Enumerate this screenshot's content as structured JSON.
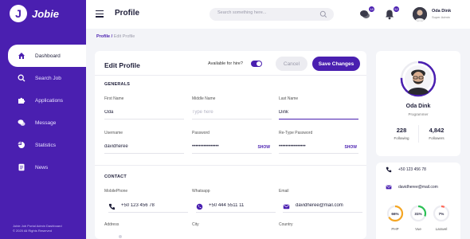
{
  "app": {
    "name": "Jobie",
    "logo_letter": "J",
    "footer_line1": "Jobie Job Portal Admin Dashboard",
    "footer_line2": "© 2020 All Rights Reserved"
  },
  "sidebar": {
    "items": [
      {
        "label": "Dashboard",
        "icon": "home-icon",
        "active": true
      },
      {
        "label": "Search Job",
        "icon": "search-icon"
      },
      {
        "label": "Applications",
        "icon": "puzzle-icon"
      },
      {
        "label": "Message",
        "icon": "chat-icon"
      },
      {
        "label": "Statistics",
        "icon": "pie-chart-icon"
      },
      {
        "label": "News",
        "icon": "document-icon"
      }
    ]
  },
  "header": {
    "title": "Profile",
    "search_placeholder": "Search something here...",
    "messages_count": "18",
    "notifications_count": "52",
    "user_name": "Oda Dink",
    "user_role": "Super Admin"
  },
  "breadcrumb": {
    "current": "Profile /",
    "sub": "Edit Profile"
  },
  "form": {
    "title": "Edit Profile",
    "hire_label": "Available for hire?",
    "hire_on": true,
    "cancel_label": "Cancel",
    "save_label": "Save Changes",
    "generals_title": "GENERALS",
    "contact_title": "CONTACT",
    "show_label": "SHOW",
    "first_name": {
      "label": "First Name",
      "value": "Oda"
    },
    "middle_name": {
      "label": "Middle Name",
      "placeholder": "Type here"
    },
    "last_name": {
      "label": "Last Name",
      "value": "Dink"
    },
    "username": {
      "label": "Username",
      "value": "davidheree"
    },
    "password": {
      "label": "Password",
      "value": "••••••••••••••••"
    },
    "retype_password": {
      "label": "Re-Type Password",
      "value": "••••••••••••••••"
    },
    "mobile": {
      "label": "MobilePhone",
      "value": "+50 123 456 78"
    },
    "whatsapp": {
      "label": "Whatsapp",
      "value": "+50 444 5511 11"
    },
    "email": {
      "label": "Email",
      "value": "davidheree@mail.com"
    },
    "address": {
      "label": "Address"
    },
    "city": {
      "label": "City"
    },
    "country": {
      "label": "Country"
    }
  },
  "profile": {
    "name": "Oda Dink",
    "role": "Programmer",
    "following": "228",
    "following_label": "Following",
    "followers": "4,842",
    "followers_label": "Followers",
    "phone": "+50 123 456 78",
    "email": "davidheree@mail.com",
    "skills": [
      {
        "label": "PHP",
        "percent_text": "66%",
        "percent": 66,
        "color": "#f5a623"
      },
      {
        "label": "Vue",
        "percent_text": "31%",
        "percent": 31,
        "color": "#2bc155"
      },
      {
        "label": "Laravel",
        "percent_text": "7%",
        "percent": 7,
        "color": "#ff6a59"
      }
    ],
    "accent_color": "#4a1fb0"
  }
}
